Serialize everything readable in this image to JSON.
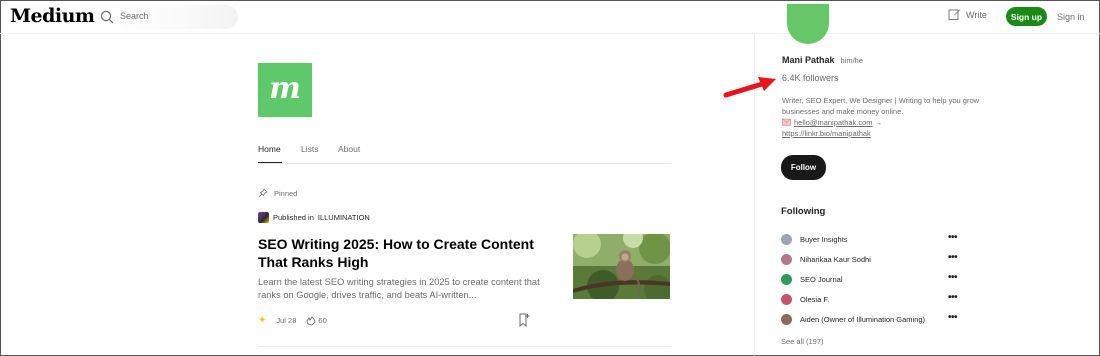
{
  "header": {
    "logo": "Medium",
    "search_placeholder": "Search",
    "write_label": "Write",
    "signup_label": "Sign up",
    "signin_label": "Sign in"
  },
  "publication": {
    "logo_letter": "m",
    "logo_color": "#5ec86a",
    "tabs": [
      {
        "label": "Home",
        "active": true
      },
      {
        "label": "Lists",
        "active": false
      },
      {
        "label": "About",
        "active": false
      }
    ]
  },
  "post": {
    "pinned_label": "Pinned",
    "published_in_prefix": "Published in",
    "publication_name": "ILLUMINATION",
    "title": "SEO Writing 2025: How to Create Content That Ranks High",
    "excerpt": "Learn the latest SEO writing strategies in 2025 to create content that ranks on Google, drives traffic, and beats AI-written...",
    "date": "Jul 28",
    "claps": "60"
  },
  "profile": {
    "name": "Mani Pathak",
    "pronouns": "him/he",
    "followers": "6.4K followers",
    "bio_line": "Writer, SEO Expert, We Designer | Writing to help you grow businesses and make money online.",
    "email_link": "hello@manipathak.com",
    "email_arrow": "→",
    "bio_link": "https://linkr.bio/manipathak",
    "follow_label": "Follow",
    "avatar_color": "#65c766"
  },
  "following": {
    "title": "Following",
    "items": [
      {
        "name": "Buyer Insights",
        "avatar_color": "#9aa6b8"
      },
      {
        "name": "Niharikaa Kaur Sodhi",
        "avatar_color": "#b07a8a"
      },
      {
        "name": "SEO Journal",
        "avatar_color": "#2f9a5a"
      },
      {
        "name": "Olesia F.",
        "avatar_color": "#c2556a"
      },
      {
        "name": "Aiden (Owner of Illumination Gaming)",
        "avatar_color": "#8a6a5a"
      }
    ],
    "see_all": "See all (197)"
  },
  "colors": {
    "accent_green": "#1a8917",
    "annotation_arrow": "#e8141b"
  }
}
